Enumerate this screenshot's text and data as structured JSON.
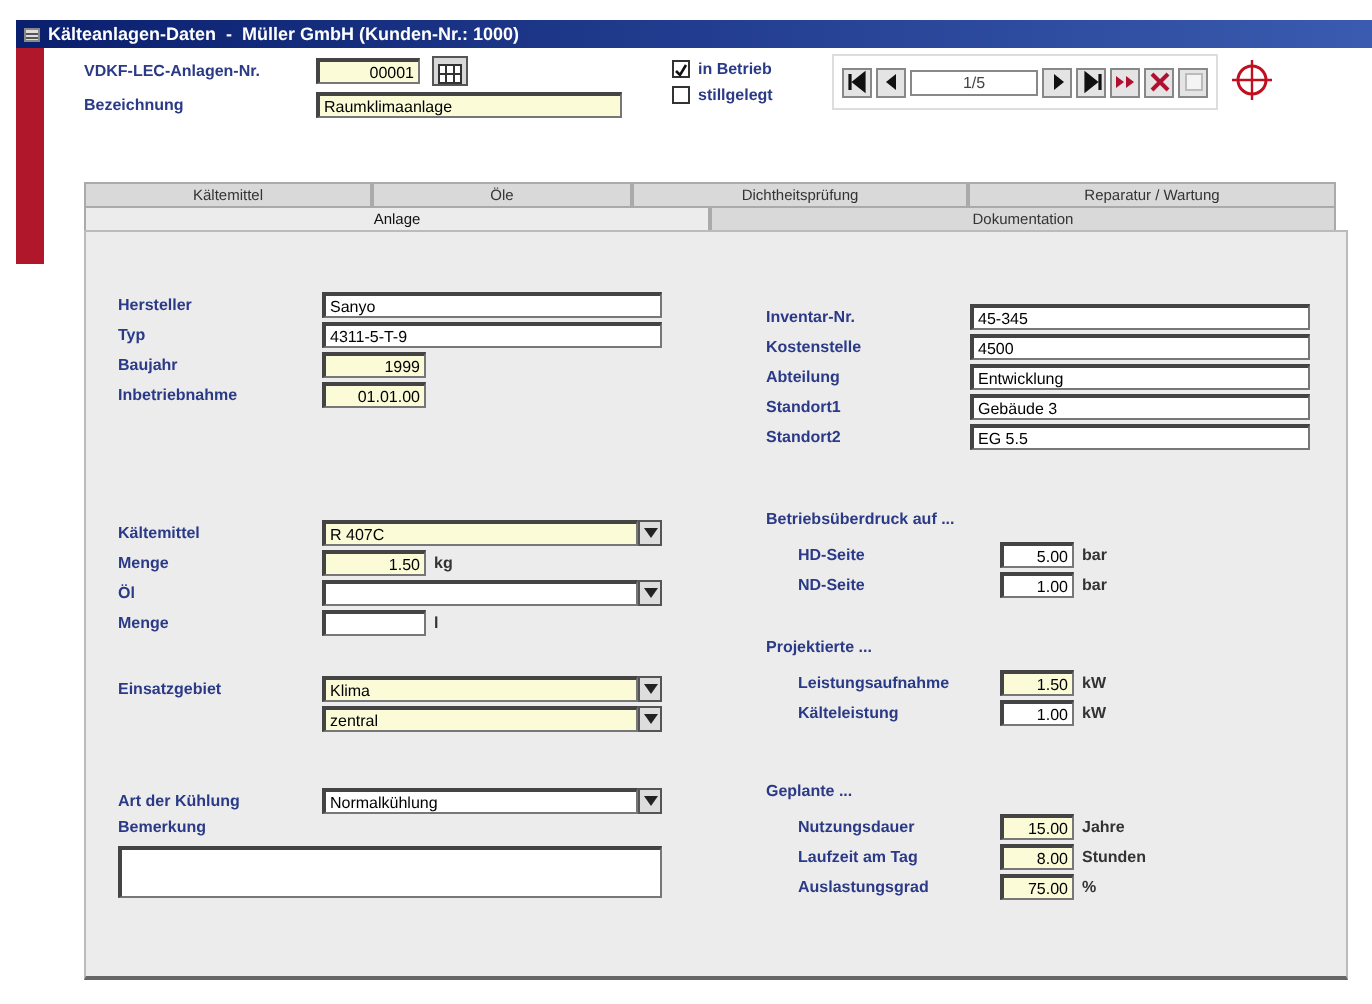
{
  "window": {
    "title": "Kälteanlagen-Daten  -  Müller GmbH (Kunden-Nr.: 1000)"
  },
  "header": {
    "fields": [
      {
        "label": "VDKF-LEC-Anlagen-Nr.",
        "value": "00001",
        "highlighted": true,
        "kind": "short"
      },
      {
        "label": "Bezeichnung",
        "value": "Raumklimaanlage",
        "highlighted": true,
        "kind": "text"
      }
    ],
    "checkboxes": [
      {
        "label": "in Betrieb",
        "checked": true
      },
      {
        "label": "stillgelegt",
        "checked": false
      }
    ],
    "record": "1/5"
  },
  "tab_rows": [
    [
      {
        "label": "Kältemittel",
        "selected": false
      },
      {
        "label": "Öle",
        "selected": false
      },
      {
        "label": "Dichtheitsprüfung",
        "selected": false
      },
      {
        "label": "Reparatur / Wartung",
        "selected": false
      }
    ],
    [
      {
        "label": "Anlage",
        "selected": true
      },
      {
        "label": "Dokumentation",
        "selected": false
      }
    ]
  ],
  "left_groups": [
    {
      "rows": [
        {
          "label": "Hersteller",
          "kind": "text",
          "value": "Sanyo",
          "highlighted": false
        },
        {
          "label": "Typ",
          "kind": "text",
          "value": "4311-5-T-9",
          "highlighted": false
        },
        {
          "label": "Baujahr",
          "kind": "short",
          "value": "1999",
          "highlighted": true
        },
        {
          "label": "Inbetriebnahme",
          "kind": "short",
          "value": "01.01.00",
          "highlighted": true
        }
      ]
    },
    {
      "rows": [
        {
          "label": "Kältemittel",
          "kind": "dropdown",
          "value": "R 407C",
          "highlighted": true
        },
        {
          "label": "Menge",
          "kind": "short",
          "value": "1.50",
          "unit": "kg",
          "highlighted": true
        },
        {
          "label": "Öl",
          "kind": "dropdown",
          "highlighted": false
        },
        {
          "label": "Menge",
          "kind": "short",
          "unit": "l",
          "highlighted": false
        }
      ]
    },
    {
      "rows": [
        {
          "label": "Einsatzgebiet",
          "kind": "dropdown",
          "value": "Klima",
          "highlighted": true
        },
        {
          "kind": "dropdown",
          "value": "zentral",
          "highlighted": true
        }
      ]
    },
    {
      "rows": [
        {
          "label": "Art der Kühlung",
          "kind": "dropdown",
          "value": "Normalkühlung",
          "highlighted": false
        },
        {
          "label": "Bemerkung",
          "kind": "memo",
          "highlighted": false
        }
      ]
    }
  ],
  "right_groups": [
    {
      "rows": [
        {
          "label": "Inventar-Nr.",
          "kind": "text",
          "value": "45-345",
          "highlighted": false
        },
        {
          "label": "Kostenstelle",
          "kind": "text",
          "value": "4500",
          "highlighted": false
        },
        {
          "label": "Abteilung",
          "kind": "text",
          "value": "Entwicklung",
          "highlighted": false
        },
        {
          "label": "Standort1",
          "kind": "text",
          "value": "Gebäude 3",
          "highlighted": false
        },
        {
          "label": "Standort2",
          "kind": "text",
          "value": "EG 5.5",
          "highlighted": false
        }
      ]
    },
    {
      "heading": "Betriebsüberdruck auf ...",
      "rows": [
        {
          "label": "HD-Seite",
          "kind": "short",
          "value": "5.00",
          "unit": "bar",
          "highlighted": false
        },
        {
          "label": "ND-Seite",
          "kind": "short",
          "value": "1.00",
          "unit": "bar",
          "highlighted": false
        }
      ]
    },
    {
      "heading": "Projektierte ...",
      "rows": [
        {
          "label": "Leistungsaufnahme",
          "kind": "short",
          "value": "1.50",
          "unit": "kW",
          "highlighted": true
        },
        {
          "label": "Kälteleistung",
          "kind": "short",
          "value": "1.00",
          "unit": "kW",
          "highlighted": false
        }
      ]
    },
    {
      "heading": "Geplante ...",
      "rows": [
        {
          "label": "Nutzungsdauer",
          "kind": "short",
          "value": "15.00",
          "unit": "Jahre",
          "highlighted": true
        },
        {
          "label": "Laufzeit am Tag",
          "kind": "short",
          "value": "8.00",
          "unit": "Stunden",
          "highlighted": true
        },
        {
          "label": "Auslastungsgrad",
          "kind": "short",
          "value": "75.00",
          "unit": "%",
          "highlighted": true
        }
      ]
    }
  ]
}
